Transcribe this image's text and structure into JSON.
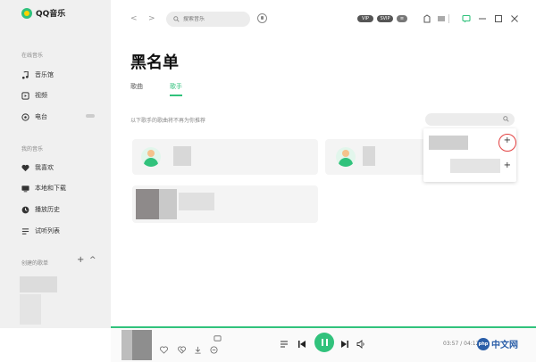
{
  "app": {
    "name": "QQ音乐"
  },
  "sidebar": {
    "sections": [
      {
        "title": "在线音乐",
        "items": [
          {
            "label": "音乐馆",
            "icon": "music-note-icon"
          },
          {
            "label": "视频",
            "icon": "video-icon"
          },
          {
            "label": "电台",
            "icon": "radio-icon"
          }
        ]
      },
      {
        "title": "我的音乐",
        "items": [
          {
            "label": "我喜欢",
            "icon": "heart-icon"
          },
          {
            "label": "本地和下载",
            "icon": "monitor-icon"
          },
          {
            "label": "播放历史",
            "icon": "clock-icon"
          },
          {
            "label": "试听列表",
            "icon": "list-icon"
          }
        ]
      },
      {
        "title": "创建的歌单"
      }
    ],
    "add_label": "+",
    "collapse_label": "^"
  },
  "topbar": {
    "back": "<",
    "forward": ">",
    "search_placeholder": "搜索音乐",
    "badges": [
      "VIP",
      "SVIP",
      "≡"
    ]
  },
  "page": {
    "title": "黑名单",
    "tabs": [
      {
        "label": "歌曲",
        "active": false
      },
      {
        "label": "歌手",
        "active": true
      }
    ],
    "hint": "以下歌手的歌曲将不再为你推荐"
  },
  "popup": {
    "add_label": "+"
  },
  "player": {
    "time": "03:57 / 04:12",
    "watermark_logo": "php",
    "watermark_text": "中文网"
  },
  "colors": {
    "accent": "#31c27c",
    "highlight_ring": "#e24040"
  }
}
